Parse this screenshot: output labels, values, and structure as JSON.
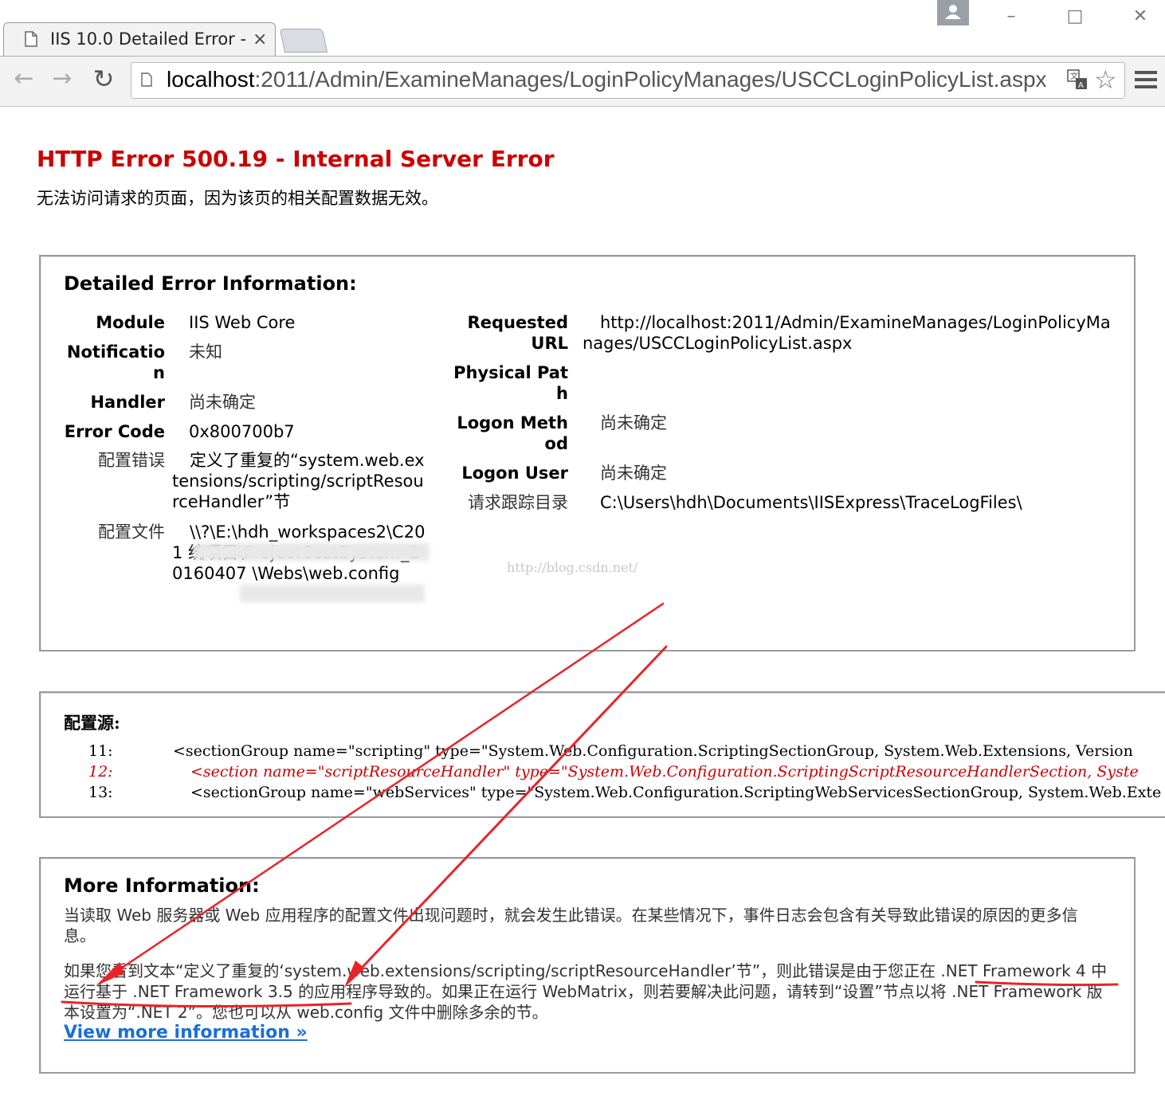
{
  "browser": {
    "tab_title": "IIS 10.0 Detailed Error -",
    "tab_close": "×",
    "url_host": "localhost",
    "url_rest": ":2011/Admin/ExamineManages/LoginPolicyManages/USCCLoginPolicyList.aspx",
    "icons": [
      "page-icon",
      "back-arrow-icon",
      "forward-arrow-icon",
      "reload-icon",
      "translate-icon",
      "star-icon",
      "menu-icon",
      "profile-icon",
      "minimize-icon",
      "maximize-icon",
      "close-icon"
    ]
  },
  "page": {
    "error_title": "HTTP Error 500.19 - Internal Server Error",
    "error_desc": "无法访问请求的页面，因为该页的相关配置数据无效。"
  },
  "detailed": {
    "heading": "Detailed Error Information:",
    "left": [
      {
        "label": "Module",
        "value": "IIS Web Core"
      },
      {
        "label": "Notification",
        "value": "未知"
      },
      {
        "label": "Handler",
        "value": "尚未确定"
      },
      {
        "label": "Error Code",
        "value": "0x800700b7"
      },
      {
        "label": "配置错误",
        "value": "定义了重复的“system.web.extensions/scripting/scriptResourceHandler”节"
      },
      {
        "label": "配置文件",
        "value": "\\\\?\\E:\\hdh_workspaces2\\C201          统项目\\ProjectCostSystem_20160407           \\Webs\\web.config"
      }
    ],
    "right": [
      {
        "label": "Requested URL",
        "value": "http://localhost:2011/Admin/ExamineManages/LoginPolicyManages/USCCLoginPolicyList.aspx"
      },
      {
        "label": "Physical Path",
        "value": ""
      },
      {
        "label": "Logon Method",
        "value": "尚未确定"
      },
      {
        "label": "Logon User",
        "value": "尚未确定"
      },
      {
        "label": "请求跟踪目录",
        "value": "C:\\Users\\hdh\\Documents\\IISExpress\\TraceLogFiles\\"
      }
    ],
    "watermark": "http://blog.csdn.net/"
  },
  "config_source": {
    "heading": "配置源:",
    "lines": [
      {
        "num": "11:",
        "code": "<sectionGroup name=\"scripting\" type=\"System.Web.Configuration.ScriptingSectionGroup, System.Web.Extensions, Version"
      },
      {
        "num": "12:",
        "code": "  <section name=\"scriptResourceHandler\" type=\"System.Web.Configuration.ScriptingScriptResourceHandlerSection, Syste"
      },
      {
        "num": "13:",
        "code": "  <sectionGroup name=\"webServices\" type=\"System.Web.Configuration.ScriptingWebServicesSectionGroup, System.Web.Exte"
      }
    ]
  },
  "more_info": {
    "heading": "More Information:",
    "para1": "当读取 Web 服务器或 Web 应用程序的配置文件出现问题时，就会发生此错误。在某些情况下，事件日志会包含有关导致此错误的原因的更多信息。",
    "para2": "如果您看到文本“定义了重复的‘system.web.extensions/scripting/scriptResourceHandler’节”，则此错误是由于您正在 .NET Framework 4 中运行基于 .NET Framework 3.5 的应用程序导致的。如果正在运行 WebMatrix，则若要解决此问题，请转到“设置”节点以将 .NET Framework 版本设置为“.NET 2”。您也可以从 web.config 文件中删除多余的节。",
    "link": "View more information »"
  },
  "colors": {
    "error_red": "#cc0000",
    "link_blue": "#1a6fd8",
    "annotation_red": "#e8242a"
  }
}
